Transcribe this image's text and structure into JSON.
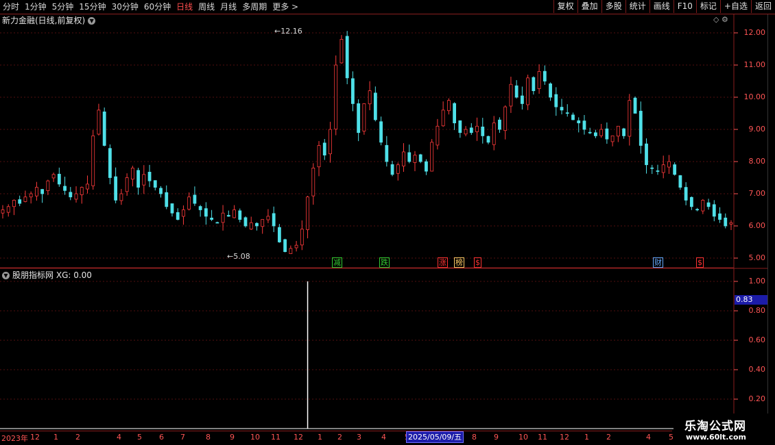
{
  "toolbar": {
    "periods": [
      "分时",
      "1分钟",
      "5分钟",
      "15分钟",
      "30分钟",
      "60分钟",
      "日线",
      "周线",
      "月线",
      "多周期",
      "更多 >"
    ],
    "active_period": "日线",
    "buttons": [
      "复权",
      "叠加",
      "多股",
      "统计",
      "画线",
      "F10",
      "标记",
      "+自选",
      "返回"
    ]
  },
  "main_panel": {
    "title": "新力金融(日线,前复权)",
    "y_ticks": [
      "12.00",
      "11.00",
      "10.00",
      "9.00",
      "8.00",
      "7.00",
      "6.00",
      "5.00"
    ],
    "high_annotation": "12.16",
    "low_annotation": "5.08",
    "events": [
      {
        "label": "减",
        "color": "#33cc33"
      },
      {
        "label": "跌",
        "color": "#33cc33"
      },
      {
        "label": "涨",
        "color": "#ff3333"
      },
      {
        "label": "榜",
        "color": "#ffcc66"
      },
      {
        "label": "$",
        "color": "#ff3333"
      },
      {
        "label": "财",
        "color": "#66aaff"
      },
      {
        "label": "$",
        "color": "#ff3333"
      }
    ]
  },
  "sub_panel": {
    "title": "股朋指标网",
    "indicator": "XG: 0.00",
    "y_ticks": [
      "1.00",
      "0.80",
      "0.60",
      "0.40",
      "0.20"
    ],
    "current_value": "0.83"
  },
  "x_axis": {
    "labels": [
      "2023年",
      "12",
      "1",
      "2",
      "4",
      "5",
      "6",
      "7",
      "8",
      "9",
      "10",
      "11",
      "12",
      "1",
      "2",
      "3",
      "4",
      "5",
      "6",
      "7",
      "8",
      "9",
      "10",
      "11",
      "12",
      "1",
      "2",
      "4",
      "5"
    ],
    "cursor_date": "2025/05/09/五"
  },
  "watermark": {
    "title": "乐淘公式网",
    "url": "www.60lt.com"
  },
  "colors": {
    "up": "#ff3b3b",
    "down": "#4fe0e8",
    "axis": "#ff5555",
    "grid": "#8a1e1e"
  },
  "chart_data": {
    "type": "candlestick",
    "y_range": [
      5.0,
      12.16
    ],
    "closes": [
      6.5,
      6.6,
      6.8,
      6.7,
      6.9,
      7.0,
      7.2,
      7.0,
      7.4,
      7.6,
      7.3,
      7.1,
      6.9,
      7.0,
      7.2,
      7.3,
      8.8,
      9.6,
      8.5,
      7.5,
      6.8,
      7.0,
      7.5,
      7.8,
      7.2,
      7.6,
      7.4,
      7.2,
      7.0,
      6.6,
      6.4,
      6.2,
      6.5,
      6.9,
      6.7,
      6.5,
      6.3,
      6.2,
      6.1,
      6.4,
      6.3,
      6.5,
      6.2,
      6.0,
      6.1,
      6.0,
      6.2,
      6.3,
      6.0,
      5.5,
      5.2,
      5.3,
      5.4,
      5.9,
      6.9,
      7.8,
      8.5,
      8.2,
      9.0,
      11.0,
      11.8,
      10.6,
      9.8,
      8.9,
      9.8,
      10.2,
      9.3,
      8.6,
      8.0,
      7.6,
      7.9,
      8.3,
      8.0,
      8.2,
      8.0,
      7.7,
      8.6,
      9.1,
      9.6,
      9.9,
      9.2,
      8.9,
      9.0,
      8.9,
      9.1,
      8.8,
      8.6,
      9.2,
      9.0,
      9.7,
      10.4,
      10.0,
      9.8,
      10.6,
      10.2,
      10.8,
      10.5,
      10.0,
      9.7,
      9.6,
      9.5,
      9.3,
      9.2,
      9.0,
      8.9,
      8.8,
      9.0,
      8.7,
      8.8,
      9.1,
      8.8,
      9.9,
      9.5,
      8.5,
      7.9,
      7.8,
      7.7,
      7.9,
      8.0,
      7.6,
      7.2,
      6.8,
      6.6,
      6.5,
      6.8,
      6.6,
      6.3,
      6.2,
      6.0,
      6.1
    ],
    "indicator_spike_index": 54,
    "indicator_spike_value": 1.0
  }
}
